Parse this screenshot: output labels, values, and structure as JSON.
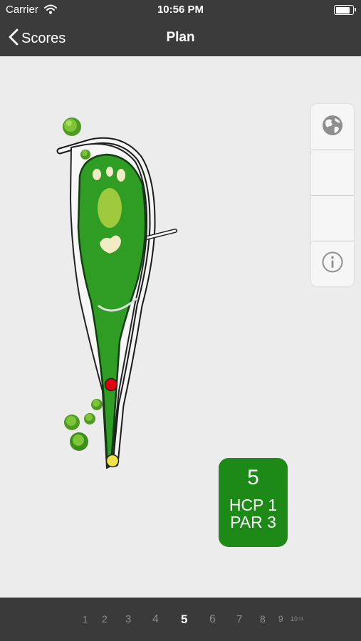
{
  "status_bar": {
    "carrier": "Carrier",
    "time": "10:56 PM"
  },
  "nav": {
    "back_label": "Scores",
    "title": "Plan"
  },
  "tools": [
    {
      "name": "globe-icon"
    },
    {
      "name": "blank"
    },
    {
      "name": "blank"
    },
    {
      "name": "info-icon"
    }
  ],
  "hole_card": {
    "number": "5",
    "hcp": "HCP 1",
    "par": "PAR 3"
  },
  "hole_selector": {
    "holes": [
      "1",
      "2",
      "3",
      "4",
      "5",
      "6",
      "7",
      "8",
      "9",
      "10",
      "11"
    ],
    "selected": "5"
  },
  "colors": {
    "bar_background": "#3b3b3b",
    "fairway_green": "#2f9d23",
    "hole_card_green": "#1d8a17",
    "pin_red": "#e0000f",
    "tee_yellow": "#f1e24a"
  }
}
